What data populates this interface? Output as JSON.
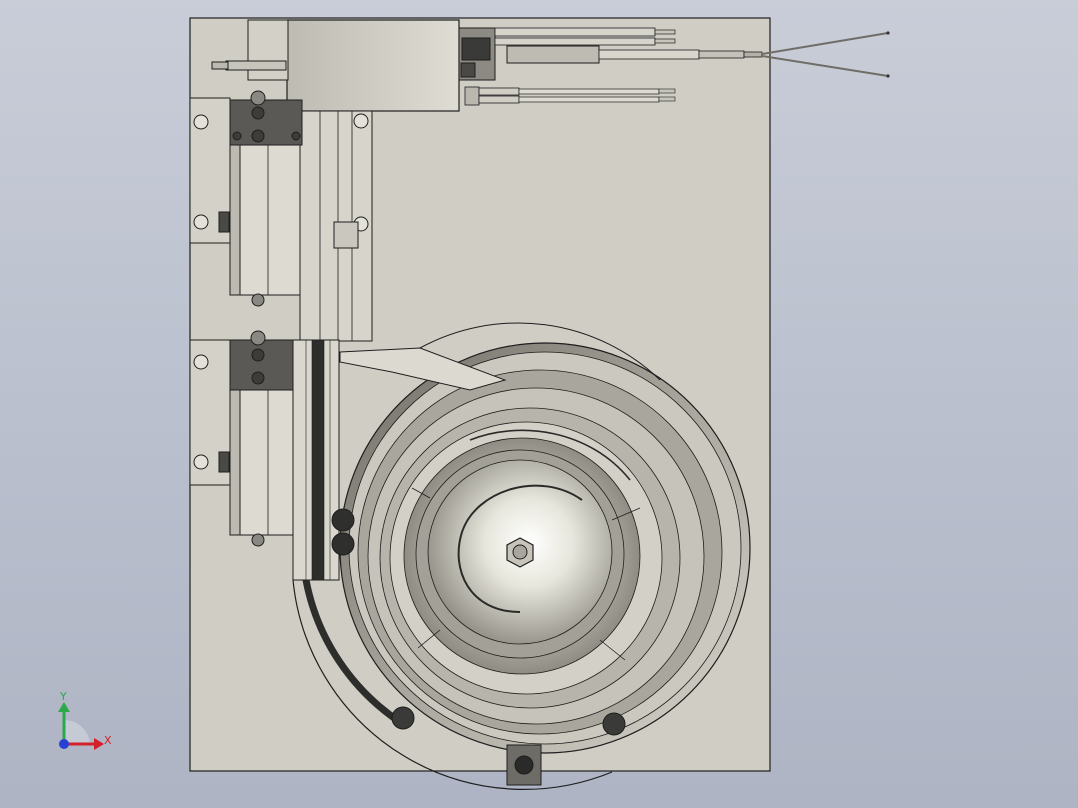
{
  "triad": {
    "x_label": "X",
    "y_label": "Y",
    "x_color": "#d4202a",
    "y_color": "#2aa84a",
    "z_color": "#2a3fd4"
  },
  "colors": {
    "background_top": "#c9cdd8",
    "background_bottom": "#aeb4c3",
    "plate": "#cfcdc4",
    "outline": "#1e1e1e"
  }
}
